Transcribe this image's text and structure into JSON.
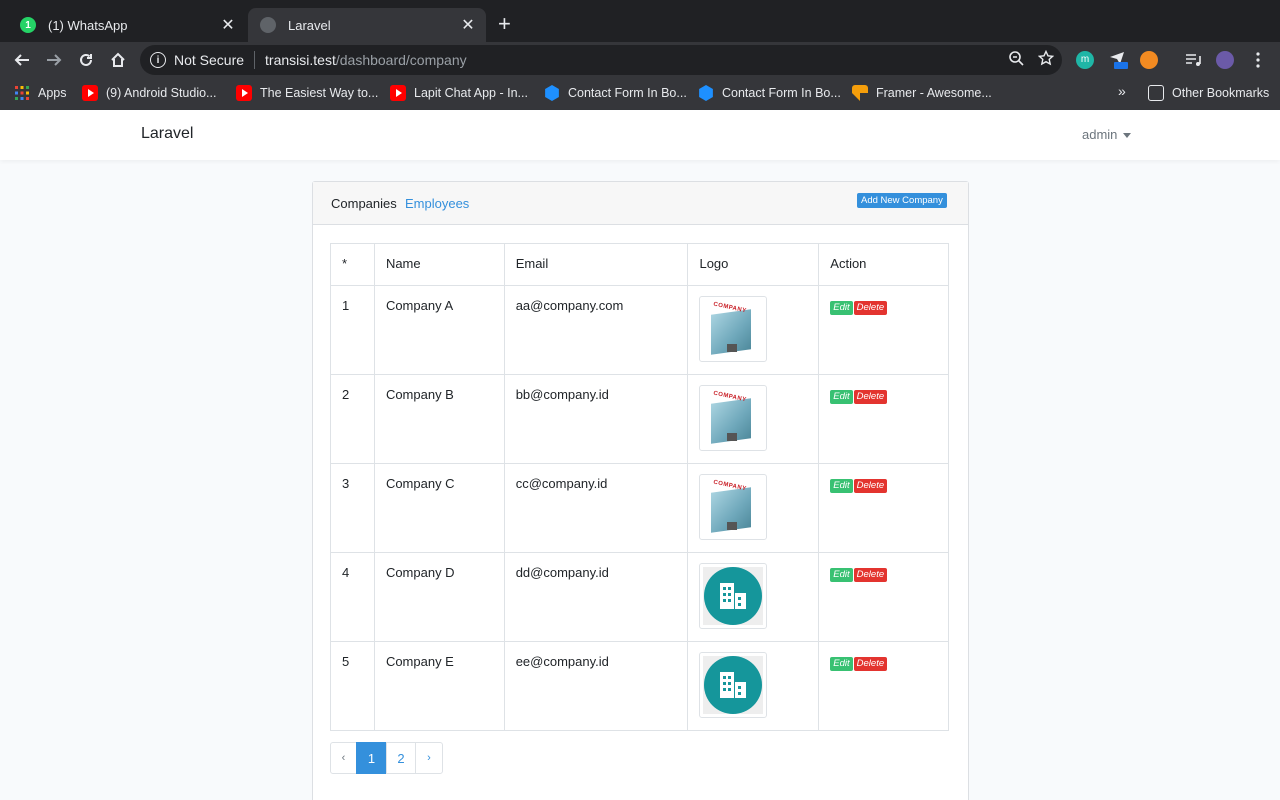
{
  "browser": {
    "tabs": [
      {
        "title": "(1) WhatsApp",
        "favicon_badge": "1"
      },
      {
        "title": "Laravel"
      }
    ],
    "new_tab": "+",
    "close": "✕",
    "omnibox": {
      "security_label": "Not Secure",
      "url_host": "transisi.test",
      "url_path": "/dashboard/company"
    },
    "extensions": [
      "m",
      "off"
    ],
    "bookmarks": [
      {
        "label": "Apps",
        "icon": "apps-grid-icon"
      },
      {
        "label": "(9) Android Studio...",
        "icon": "youtube-icon"
      },
      {
        "label": "The Easiest Way to...",
        "icon": "youtube-icon"
      },
      {
        "label": "Lapit Chat App - In...",
        "icon": "youtube-icon"
      },
      {
        "label": "Contact Form In Bo...",
        "icon": "hexagon-icon"
      },
      {
        "label": "Contact Form In Bo...",
        "icon": "hexagon-icon"
      },
      {
        "label": "Framer - Awesome...",
        "icon": "framer-icon"
      }
    ],
    "bookmarks_overflow": "»",
    "other_bookmarks": "Other Bookmarks"
  },
  "app": {
    "brand": "Laravel",
    "user": "admin"
  },
  "card": {
    "nav_companies": "Companies",
    "nav_employees": "Employees",
    "add_button": "Add New Company"
  },
  "table": {
    "headers": [
      "*",
      "Name",
      "Email",
      "Logo",
      "Action"
    ],
    "rows": [
      {
        "num": "1",
        "name": "Company A",
        "email": "aa@company.com",
        "logo": "building-illustration"
      },
      {
        "num": "2",
        "name": "Company B",
        "email": "bb@company.id",
        "logo": "building-illustration"
      },
      {
        "num": "3",
        "name": "Company C",
        "email": "cc@company.id",
        "logo": "building-illustration"
      },
      {
        "num": "4",
        "name": "Company D",
        "email": "dd@company.id",
        "logo": "teal-circle-building-icon"
      },
      {
        "num": "5",
        "name": "Company E",
        "email": "ee@company.id",
        "logo": "teal-circle-building-icon"
      }
    ],
    "edit_label": "Edit",
    "delete_label": "Delete",
    "logo_sign_text": "COMPANY"
  },
  "pagination": {
    "prev": "‹",
    "pages": [
      "1",
      "2"
    ],
    "current": "1",
    "next": "›"
  },
  "colors": {
    "primary": "#3490dc",
    "success": "#38c172",
    "danger": "#e3342f",
    "logo_teal": "#15969b"
  }
}
